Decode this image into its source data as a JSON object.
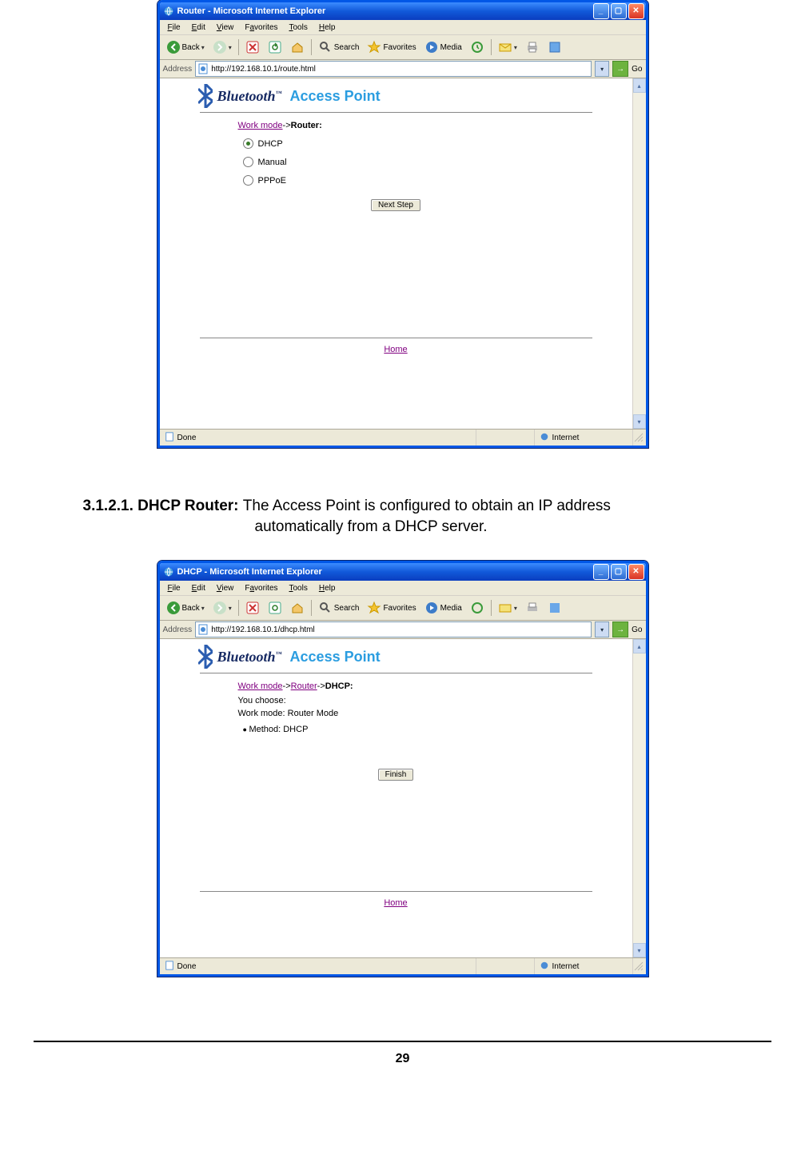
{
  "screenshot1": {
    "title": "Router - Microsoft Internet Explorer",
    "menu": {
      "file": "File",
      "edit": "Edit",
      "view": "View",
      "favorites": "Favorites",
      "tools": "Tools",
      "help": "Help"
    },
    "toolbar": {
      "back": "Back",
      "search": "Search",
      "favorites": "Favorites",
      "media": "Media"
    },
    "addressLabel": "Address",
    "addressUrl": "http://192.168.10.1/route.html",
    "go": "Go",
    "logoBluetooth": "Bluetooth",
    "logoTM": "™",
    "logoAP": "Access Point",
    "breadcrumb_workmode": "Work mode",
    "breadcrumb_arrow": "->",
    "breadcrumb_router": "Router:",
    "options": {
      "dhcp": "DHCP",
      "manual": "Manual",
      "pppoe": "PPPoE"
    },
    "nextStep": "Next Step",
    "home": "Home",
    "statusDone": "Done",
    "statusZone": "Internet"
  },
  "doc": {
    "heading": "3.1.2.1. DHCP Router: ",
    "body1": "The Access Point is configured to obtain an IP address ",
    "body2": "automatically from a DHCP server."
  },
  "screenshot2": {
    "title": "DHCP - Microsoft Internet Explorer",
    "addressUrl": "http://192.168.10.1/dhcp.html",
    "breadcrumb_workmode": "Work mode",
    "breadcrumb_router": "Router",
    "breadcrumb_arrow": "->",
    "breadcrumb_dhcp": "DHCP:",
    "youChoose": "You choose:",
    "workModeLine": "Work mode: Router Mode",
    "methodLine": "Method: DHCP",
    "finish": "Finish",
    "home": "Home"
  },
  "pageNumber": "29"
}
